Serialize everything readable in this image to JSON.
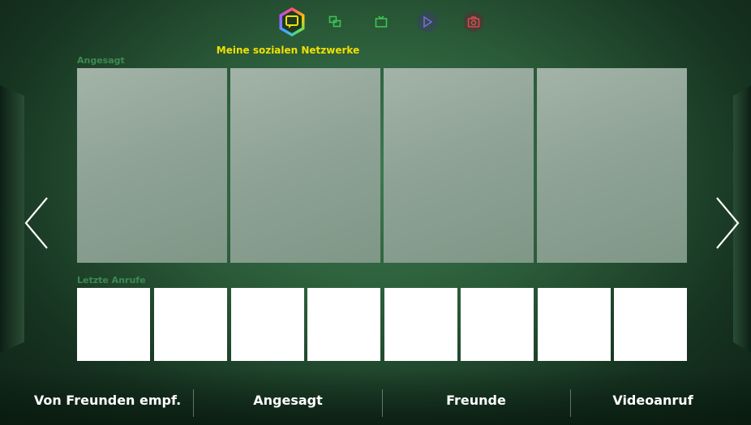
{
  "top_nav": {
    "title": "Meine sozialen Netzwerke",
    "icons": [
      "social-hub-icon",
      "multi-screen-icon",
      "tv-icon",
      "play-icon",
      "camera-icon"
    ],
    "active_index": 0
  },
  "featured": {
    "label": "Angesagt",
    "tiles": 4
  },
  "recent_calls": {
    "label": "Letzte Anrufe",
    "tiles": 8
  },
  "bottom_nav": {
    "items": [
      "Von Freunden empf.",
      "Angesagt",
      "Freunde",
      "Videoanruf"
    ]
  },
  "colors": {
    "title_yellow": "#f0e000",
    "label_green": "#3e8a52",
    "icon_green": "#3cc25a",
    "icon_purple": "#7a6ad6",
    "icon_red": "#d84a50"
  }
}
